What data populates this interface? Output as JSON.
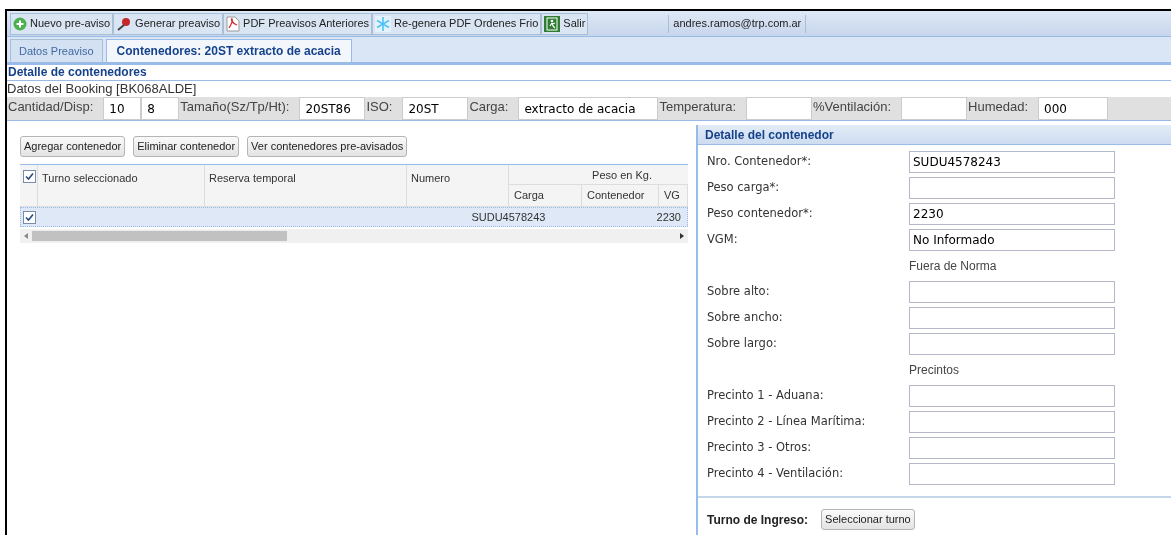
{
  "toolbar": {
    "buttons": [
      {
        "label": "Nuevo pre-aviso",
        "kind": "add"
      },
      {
        "label": "Generar preaviso",
        "kind": "pin"
      },
      {
        "label": "PDF Preavisos Anteriores",
        "kind": "pdf"
      },
      {
        "label": "Re-genera PDF Ordenes Frio",
        "kind": "snow"
      },
      {
        "label": "Salir",
        "kind": "exit"
      }
    ],
    "user": "andres.ramos@trp.com.ar"
  },
  "tabs": [
    {
      "label": "Datos Preaviso",
      "selected": false
    },
    {
      "label": "Contenedores: 20ST extracto de acacia",
      "selected": true
    }
  ],
  "section_title": "Detalle de contenedores",
  "booking": "Datos del Booking [BK068ALDE]",
  "booking_fields": [
    {
      "label": "Cantidad/Disp:",
      "values": [
        "10",
        "8"
      ]
    },
    {
      "label": "Tamaño(Sz/Tp/Ht):",
      "values": [
        "20ST86"
      ]
    },
    {
      "label": "ISO:",
      "values": [
        "20ST"
      ]
    },
    {
      "label": "Carga:",
      "values": [
        "extracto de acacia"
      ]
    },
    {
      "label": "Temperatura:"
    },
    {
      "label": "%Ventilación:"
    },
    {
      "label": "Humedad:",
      "values": [
        "000"
      ]
    }
  ],
  "list_buttons": [
    "Agregar contenedor",
    "Eliminar contenedor",
    "Ver contenedores pre-avisados"
  ],
  "grid": {
    "all_checked": true,
    "columns": [
      "Turno seleccionado",
      "Reserva temporal",
      "Numero"
    ],
    "group": "Peso en Kg.",
    "subcolumns": [
      "Carga",
      "Contenedor",
      "VG"
    ],
    "rows": [
      {
        "checked": true,
        "selected": true,
        "numero": "SUDU4578243",
        "contenedor": "2230"
      }
    ]
  },
  "detail": {
    "title": "Detalle del contenedor",
    "items": [
      {
        "kind": "field",
        "label": "Nro. Contenedor*:",
        "value": "SUDU4578243"
      },
      {
        "kind": "field",
        "label": "Peso carga*:",
        "value": ""
      },
      {
        "kind": "field",
        "label": "Peso contenedor*:",
        "value": "2230"
      },
      {
        "kind": "field",
        "label": "VGM:",
        "value": "No Informado"
      },
      {
        "kind": "heading",
        "label": "Fuera de Norma"
      },
      {
        "kind": "field",
        "label": "Sobre alto:",
        "value": ""
      },
      {
        "kind": "field",
        "label": "Sobre ancho:",
        "value": ""
      },
      {
        "kind": "field",
        "label": "Sobre largo:",
        "value": ""
      },
      {
        "kind": "heading",
        "label": "Precintos"
      },
      {
        "kind": "field",
        "label": "Precinto 1 - Aduana:",
        "value": ""
      },
      {
        "kind": "field",
        "label": "Precinto 2 - Línea Marítima:",
        "value": ""
      },
      {
        "kind": "field",
        "label": "Precinto 3 - Otros:",
        "value": ""
      },
      {
        "kind": "field",
        "label": "Precinto 4 - Ventilación:",
        "value": ""
      }
    ],
    "turno_label": "Turno de Ingreso:",
    "turno_button": "Seleccionar turno"
  }
}
